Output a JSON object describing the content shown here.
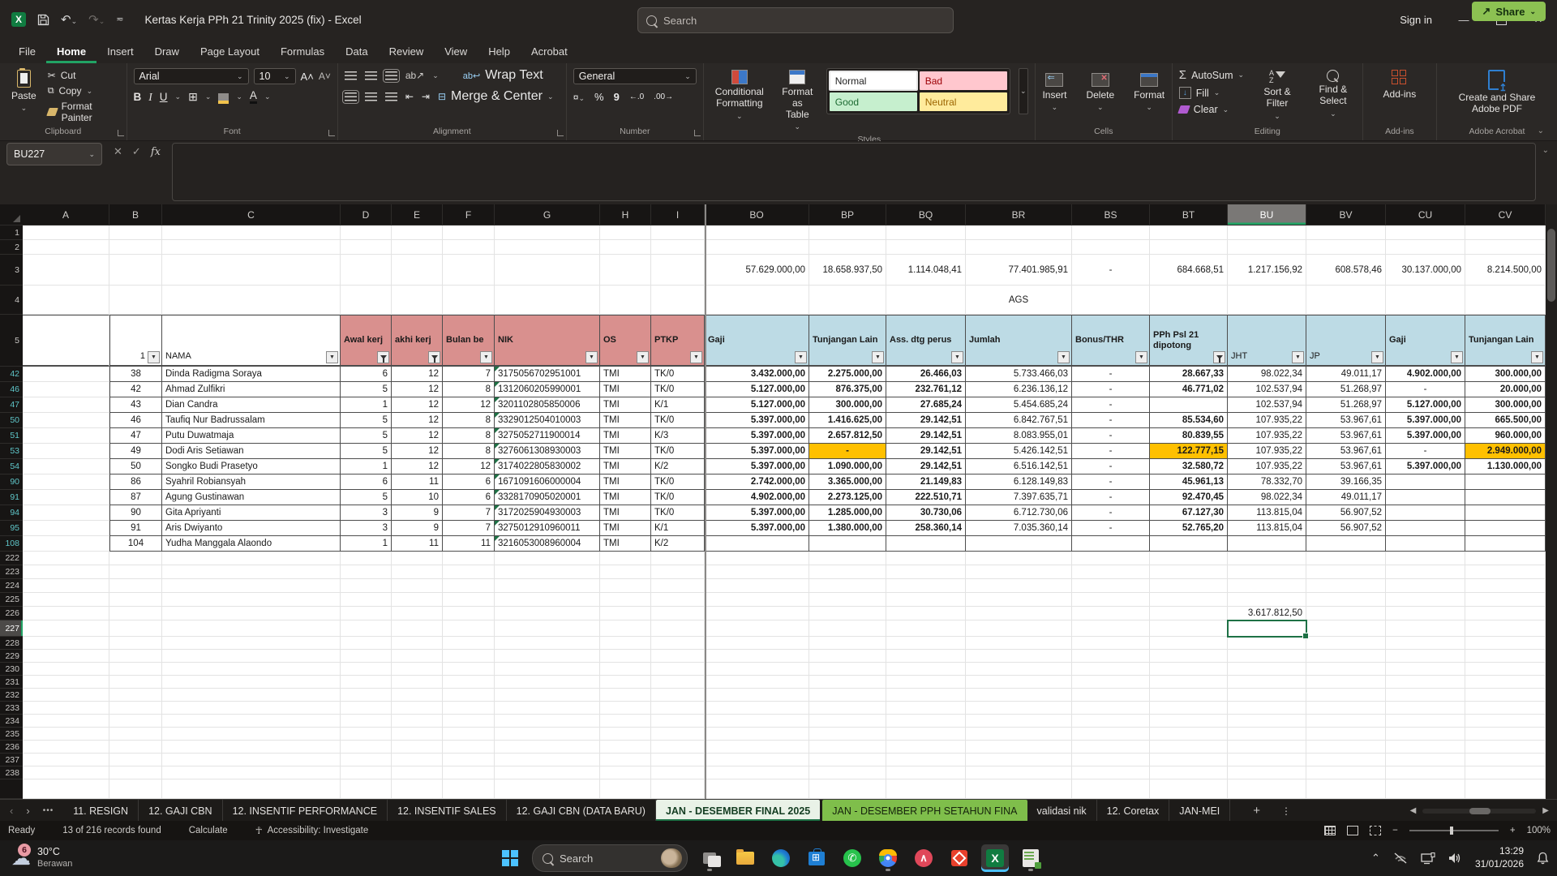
{
  "titlebar": {
    "title": "Kertas Kerja PPh 21 Trinity 2025 (fix)  -  Excel",
    "search_placeholder": "Search",
    "sign_in": "Sign in"
  },
  "ribbon": {
    "tabs": [
      "File",
      "Home",
      "Insert",
      "Draw",
      "Page Layout",
      "Formulas",
      "Data",
      "Review",
      "View",
      "Help",
      "Acrobat"
    ],
    "active_tab": "Home",
    "share_label": "Share",
    "clipboard": {
      "label": "Clipboard",
      "paste": "Paste",
      "cut": "Cut",
      "copy": "Copy",
      "format_painter": "Format Painter"
    },
    "font": {
      "label": "Font",
      "family": "Arial",
      "size": "10"
    },
    "alignment": {
      "label": "Alignment",
      "wrap": "Wrap Text",
      "merge": "Merge & Center"
    },
    "number": {
      "label": "Number",
      "format": "General"
    },
    "styles": {
      "label": "Styles",
      "conditional": "Conditional Formatting",
      "format_table": "Format as Table",
      "gallery": [
        "Normal",
        "Bad",
        "Good",
        "Neutral"
      ]
    },
    "cells": {
      "label": "Cells",
      "insert": "Insert",
      "delete": "Delete",
      "format": "Format"
    },
    "editing": {
      "label": "Editing",
      "autosum": "AutoSum",
      "fill": "Fill",
      "clear": "Clear",
      "sort": "Sort & Filter",
      "find": "Find & Select"
    },
    "addins": {
      "label": "Add-ins",
      "button": "Add-ins"
    },
    "acrobat": {
      "label": "Adobe Acrobat",
      "button": "Create and Share Adobe PDF"
    }
  },
  "formula_bar": {
    "name_box": "BU227",
    "value": ""
  },
  "grid": {
    "columns": [
      "A",
      "B",
      "C",
      "D",
      "E",
      "F",
      "G",
      "H",
      "I",
      "BO",
      "BP",
      "BQ",
      "BR",
      "BS",
      "BT",
      "BU",
      "BV",
      "CU",
      "CV"
    ],
    "selected_column": "BU",
    "selected_cell": "BU227",
    "row3_totals": [
      "57.629.000,00",
      "18.658.937,50",
      "1.114.048,41",
      "77.401.985,91",
      "-",
      "684.668,51",
      "1.217.156,92",
      "608.578,46",
      "30.137.000,00",
      "8.214.500,00"
    ],
    "row4_label": "AGS",
    "header": {
      "b": "1",
      "c": "NAMA",
      "left": [
        "Awal kerj",
        "akhi kerj",
        "Bulan be",
        "NIK",
        "OS",
        "PTKP"
      ],
      "right": [
        "Gaji",
        "Tunjangan Lain",
        "Ass. dtg perus",
        "Jumlah",
        "Bonus/THR",
        "PPh Psl 21 dipotong",
        "JHT",
        "JP",
        "Gaji",
        "Tunjangan Lain"
      ]
    },
    "rows": [
      {
        "r": "42",
        "no": "38",
        "nama": "Dinda Radigma Soraya",
        "awal": "6",
        "akhir": "12",
        "bulan": "7",
        "nik": "3175056702951001",
        "os": "TMI",
        "ptkp": "TK/0",
        "vals": [
          "3.432.000,00",
          "2.275.000,00",
          "26.466,03",
          "5.733.466,03",
          "-",
          "28.667,33",
          "98.022,34",
          "49.011,17",
          "4.902.000,00",
          "300.000,00"
        ],
        "hl": []
      },
      {
        "r": "46",
        "no": "42",
        "nama": "Ahmad Zulfikri",
        "awal": "5",
        "akhir": "12",
        "bulan": "8",
        "nik": "1312060205990001",
        "os": "TMI",
        "ptkp": "TK/0",
        "vals": [
          "5.127.000,00",
          "876.375,00",
          "232.761,12",
          "6.236.136,12",
          "-",
          "46.771,02",
          "102.537,94",
          "51.268,97",
          "-",
          "20.000,00"
        ],
        "hl": []
      },
      {
        "r": "47",
        "no": "43",
        "nama": "Dian Candra",
        "awal": "1",
        "akhir": "12",
        "bulan": "12",
        "nik": "3201102805850006",
        "os": "TMI",
        "ptkp": "K/1",
        "vals": [
          "5.127.000,00",
          "300.000,00",
          "27.685,24",
          "5.454.685,24",
          "-",
          "",
          "102.537,94",
          "51.268,97",
          "5.127.000,00",
          "300.000,00"
        ],
        "hl": []
      },
      {
        "r": "50",
        "no": "46",
        "nama": "Taufiq Nur Badrussalam",
        "awal": "5",
        "akhir": "12",
        "bulan": "8",
        "nik": "3329012504010003",
        "os": "TMI",
        "ptkp": "TK/0",
        "vals": [
          "5.397.000,00",
          "1.416.625,00",
          "29.142,51",
          "6.842.767,51",
          "-",
          "85.534,60",
          "107.935,22",
          "53.967,61",
          "5.397.000,00",
          "665.500,00"
        ],
        "hl": []
      },
      {
        "r": "51",
        "no": "47",
        "nama": "Putu Duwatmaja",
        "awal": "5",
        "akhir": "12",
        "bulan": "8",
        "nik": "3275052711900014",
        "os": "TMI",
        "ptkp": "K/3",
        "vals": [
          "5.397.000,00",
          "2.657.812,50",
          "29.142,51",
          "8.083.955,01",
          "-",
          "80.839,55",
          "107.935,22",
          "53.967,61",
          "5.397.000,00",
          "960.000,00"
        ],
        "hl": []
      },
      {
        "r": "53",
        "no": "49",
        "nama": "Dodi Aris Setiawan",
        "awal": "5",
        "akhir": "12",
        "bulan": "8",
        "nik": "3276061308930003",
        "os": "TMI",
        "ptkp": "TK/0",
        "vals": [
          "5.397.000,00",
          "-",
          "29.142,51",
          "5.426.142,51",
          "-",
          "122.777,15",
          "107.935,22",
          "53.967,61",
          "-",
          "2.949.000,00"
        ],
        "hl": [
          1,
          5,
          9
        ]
      },
      {
        "r": "54",
        "no": "50",
        "nama": "Songko Budi Prasetyo",
        "awal": "1",
        "akhir": "12",
        "bulan": "12",
        "nik": "3174022805830002",
        "os": "TMI",
        "ptkp": "K/2",
        "vals": [
          "5.397.000,00",
          "1.090.000,00",
          "29.142,51",
          "6.516.142,51",
          "-",
          "32.580,72",
          "107.935,22",
          "53.967,61",
          "5.397.000,00",
          "1.130.000,00"
        ],
        "hl": []
      },
      {
        "r": "90",
        "no": "86",
        "nama": "Syahril Robiansyah",
        "awal": "6",
        "akhir": "11",
        "bulan": "6",
        "nik": "1671091606000004",
        "os": "TMI",
        "ptkp": "TK/0",
        "vals": [
          "2.742.000,00",
          "3.365.000,00",
          "21.149,83",
          "6.128.149,83",
          "-",
          "45.961,13",
          "78.332,70",
          "39.166,35",
          "",
          ""
        ],
        "hl": []
      },
      {
        "r": "91",
        "no": "87",
        "nama": "Agung Gustinawan",
        "awal": "5",
        "akhir": "10",
        "bulan": "6",
        "nik": "3328170905020001",
        "os": "TMI",
        "ptkp": "TK/0",
        "vals": [
          "4.902.000,00",
          "2.273.125,00",
          "222.510,71",
          "7.397.635,71",
          "-",
          "92.470,45",
          "98.022,34",
          "49.011,17",
          "",
          ""
        ],
        "hl": []
      },
      {
        "r": "94",
        "no": "90",
        "nama": "Gita Apriyanti",
        "awal": "3",
        "akhir": "9",
        "bulan": "7",
        "nik": "3172025904930003",
        "os": "TMI",
        "ptkp": "TK/0",
        "vals": [
          "5.397.000,00",
          "1.285.000,00",
          "30.730,06",
          "6.712.730,06",
          "-",
          "67.127,30",
          "113.815,04",
          "56.907,52",
          "",
          ""
        ],
        "hl": []
      },
      {
        "r": "95",
        "no": "91",
        "nama": "Aris Dwiyanto",
        "awal": "3",
        "akhir": "9",
        "bulan": "7",
        "nik": "3275012910960011",
        "os": "TMI",
        "ptkp": "K/1",
        "vals": [
          "5.397.000,00",
          "1.380.000,00",
          "258.360,14",
          "7.035.360,14",
          "-",
          "52.765,20",
          "113.815,04",
          "56.907,52",
          "",
          ""
        ],
        "hl": []
      },
      {
        "r": "108",
        "no": "104",
        "nama": "Yudha Manggala Alaondo",
        "awal": "1",
        "akhir": "11",
        "bulan": "11",
        "nik": "3216053008960004",
        "os": "TMI",
        "ptkp": "K/2",
        "vals": [
          "",
          "",
          "",
          "",
          "",
          "",
          "",
          "",
          "",
          ""
        ],
        "hl": []
      }
    ],
    "tail_start": 222,
    "tail_end": 238,
    "bu226_value": "3.617.812,50"
  },
  "sheet_bar": {
    "tabs": [
      {
        "label": "11. RESIGN",
        "type": "normal"
      },
      {
        "label": "12. GAJI CBN",
        "type": "normal"
      },
      {
        "label": "12. INSENTIF PERFORMANCE",
        "type": "normal"
      },
      {
        "label": "12. INSENTIF SALES",
        "type": "normal"
      },
      {
        "label": "12. GAJI CBN (DATA BARU)",
        "type": "normal"
      },
      {
        "label": "JAN - DESEMBER FINAL 2025",
        "type": "active"
      },
      {
        "label": "JAN - DESEMBER PPH SETAHUN FINA",
        "type": "green"
      },
      {
        "label": "validasi nik",
        "type": "normal"
      },
      {
        "label": "12. Coretax",
        "type": "normal"
      },
      {
        "label": "JAN-MEI",
        "type": "normal"
      }
    ]
  },
  "status_bar": {
    "ready": "Ready",
    "records": "13 of 216 records found",
    "calculate": "Calculate",
    "accessibility": "Accessibility: Investigate",
    "zoom": "100%"
  },
  "taskbar": {
    "weather_temp": "30°C",
    "weather_desc": "Berawan",
    "weather_badge": "6",
    "search_placeholder": "Search",
    "time": "13:29",
    "date": "31/01/2026"
  },
  "colors": {
    "accent_green": "#1e7145",
    "header_pink": "#d9908e",
    "header_blue": "#bddbe5",
    "highlight_orange": "#ffc000",
    "green_tab": "#7fbe4b",
    "taskbar_accent": "#4cc2ff"
  }
}
